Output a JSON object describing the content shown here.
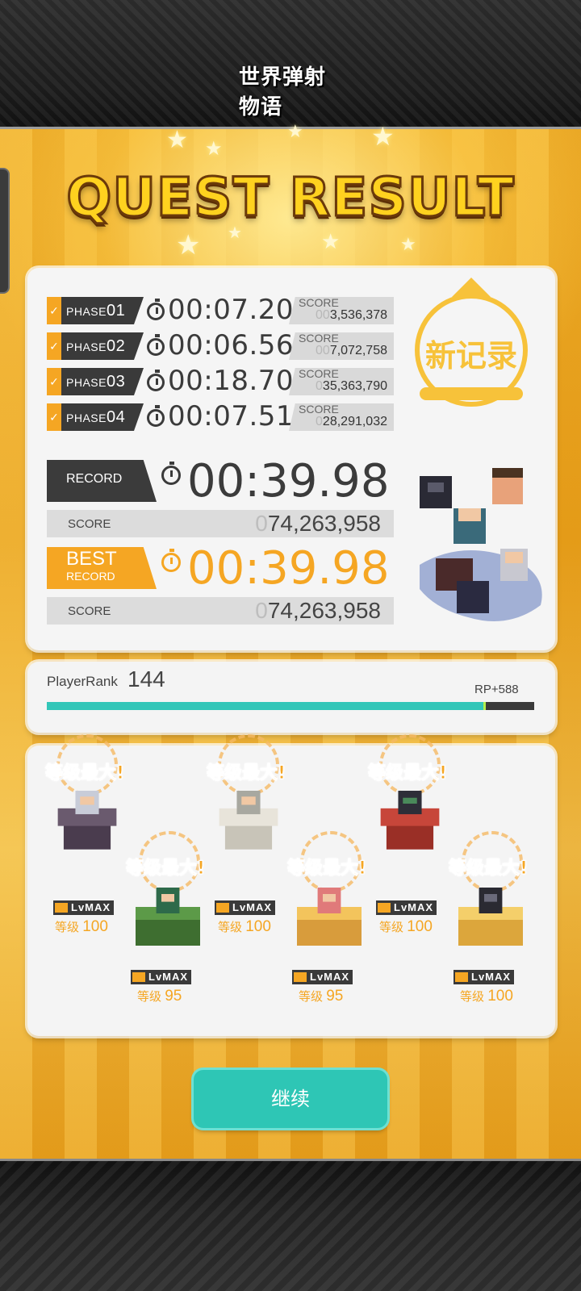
{
  "header": {
    "logo_text": "世界弹射物语"
  },
  "title": "QUEST RESULT",
  "phases": [
    {
      "label_prefix": "PHASE",
      "label_num": "01",
      "time": "00:07.20",
      "score_label": "SCORE",
      "score_dim": "00",
      "score": "3,536,378"
    },
    {
      "label_prefix": "PHASE",
      "label_num": "02",
      "time": "00:06.56",
      "score_label": "SCORE",
      "score_dim": "00",
      "score": "7,072,758"
    },
    {
      "label_prefix": "PHASE",
      "label_num": "03",
      "time": "00:18.70",
      "score_label": "SCORE",
      "score_dim": "0",
      "score": "35,363,790"
    },
    {
      "label_prefix": "PHASE",
      "label_num": "04",
      "time": "00:07.51",
      "score_label": "SCORE",
      "score_dim": "0",
      "score": "28,291,032"
    }
  ],
  "record": {
    "label": "RECORD",
    "time": "00:39.98",
    "score_label": "SCORE",
    "score_dim": "0",
    "score": "74,263,958"
  },
  "best": {
    "label_line1": "BEST",
    "label_line2": "RECORD",
    "time": "00:39.98",
    "score_label": "SCORE",
    "score_dim": "0",
    "score": "74,263,958"
  },
  "new_record_stamp": "新记录",
  "player_rank": {
    "label": "PlayerRank",
    "value": "144",
    "rp": "RP+588",
    "progress": 0.9
  },
  "characters": [
    {
      "badge": "等级最大!",
      "lv_badge": "LvMAX",
      "level_prefix": "等级",
      "level": "100",
      "color": "#6a5a6e"
    },
    {
      "badge": "等级最大!",
      "lv_badge": "LvMAX",
      "level_prefix": "等级",
      "level": "95",
      "color": "#4e8a3c"
    },
    {
      "badge": "等级最大!",
      "lv_badge": "LvMAX",
      "level_prefix": "等级",
      "level": "100",
      "color": "#e8e4da"
    },
    {
      "badge": "等级最大!",
      "lv_badge": "LvMAX",
      "level_prefix": "等级",
      "level": "95",
      "color": "#f3c45c"
    },
    {
      "badge": "等级最大!",
      "lv_badge": "LvMAX",
      "level_prefix": "等级",
      "level": "100",
      "color": "#c7463a"
    },
    {
      "badge": "等级最大!",
      "lv_badge": "LvMAX",
      "level_prefix": "等级",
      "level": "100",
      "color": "#f4cf6a"
    }
  ],
  "continue_button": "继续",
  "colors": {
    "accent": "#f5a623",
    "teal": "#2ec6b5",
    "dark": "#3b3b3b"
  }
}
